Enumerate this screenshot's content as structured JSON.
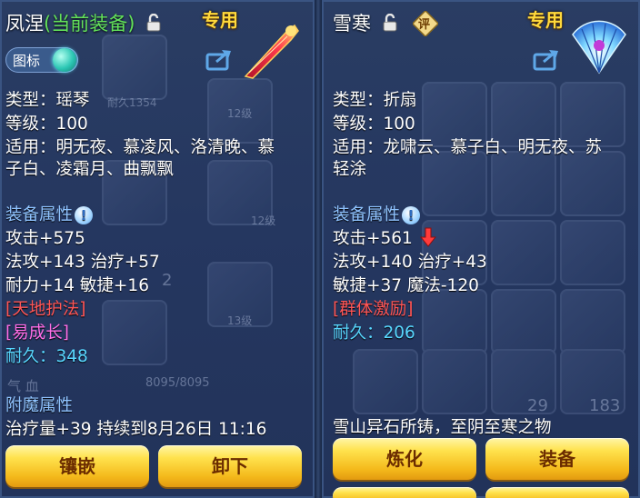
{
  "left": {
    "item_name": "凤涅",
    "equipped_tag": "(当前装备)",
    "exclusive_label": "专用",
    "icon_toggle_label": "图标",
    "lines": {
      "type": "类型：瑶琴",
      "level": "等级：100",
      "suitable1": "适用：明无夜、慕凌风、洛清晚、慕",
      "suitable2": "子白、凌霜月、曲飘飘",
      "attr_header": "装备属性",
      "attack": "攻击+575",
      "stats1": "法攻+143  治疗+57",
      "stats2": "耐力+14  敏捷+16",
      "effect1": "[天地护法]",
      "effect2": "[易成长]",
      "durability_label": "耐久：",
      "durability_value": "348",
      "enchant_header": "附魔属性",
      "enchant1": "治疗量+39  持续到8月26日 11:16"
    },
    "buttons": {
      "inlay": "镶嵌",
      "unequip": "卸下"
    },
    "background_text": {
      "durability_hint": "耐久1354",
      "level12a": "12级",
      "level12b": "12级",
      "level13": "13级",
      "number2": "2",
      "hp_label": "气 血",
      "hp_value": "8095/8095"
    }
  },
  "right": {
    "item_name": "雪寒",
    "exclusive_label": "专用",
    "rating_badge": "评",
    "lines": {
      "type": "类型：折扇",
      "level": "等级：100",
      "suitable1": "适用：龙啸云、慕子白、明无夜、苏",
      "suitable2": "轻涂",
      "attr_header": "装备属性",
      "attack": "攻击+561",
      "stats1": "法攻+140  治疗+43",
      "stats2": "敏捷+37  魔法-120",
      "effect1": "[群体激励]",
      "durability_label": "耐久：",
      "durability_value": "206",
      "description": "雪山异石所铸，至阴至寒之物"
    },
    "buttons": {
      "refine": "炼化",
      "equip": "装备"
    },
    "background_text": {
      "count1": "29",
      "count2": "183"
    }
  },
  "colors": {
    "panel_bg": "#2a3d63",
    "name_green": "#63e25a",
    "exclusive_gold": "#ffd93b",
    "section_blue": "#8fc3ff",
    "effect_red": "#ff5656",
    "effect_pink": "#ff6fe9",
    "durability_cyan": "#58d7ff",
    "button_gold": "#f4b91b"
  },
  "icons": [
    "lock-icon",
    "share-icon",
    "info-icon",
    "down-arrow-icon",
    "instrument-item-icon",
    "fan-item-icon",
    "toggle-knob-icon",
    "rating-badge-icon"
  ]
}
